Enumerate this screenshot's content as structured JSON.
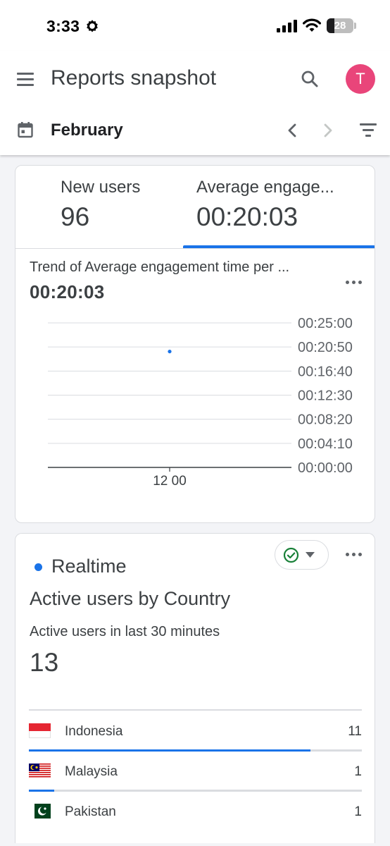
{
  "status_bar": {
    "time": "3:33",
    "battery_level": "28"
  },
  "header": {
    "title": "Reports snapshot",
    "avatar_initial": "T",
    "date_range": "February"
  },
  "metric_tabs": [
    {
      "label": "New users",
      "value": "96"
    },
    {
      "label": "Average engage...",
      "value": "00:20:03"
    }
  ],
  "selected_tab": 1,
  "trend_card": {
    "title": "Trend of Average engagement time per ...",
    "value": "00:20:03"
  },
  "chart_data": {
    "type": "scatter",
    "title": "Trend of Average engagement time per ...",
    "x_tick_labels": [
      "12 00"
    ],
    "y_tick_labels": [
      "00:25:00",
      "00:20:50",
      "00:16:40",
      "00:12:30",
      "00:08:20",
      "00:04:10",
      "00:00:00"
    ],
    "y_tick_seconds": [
      1500,
      1250,
      1000,
      750,
      500,
      250,
      0
    ],
    "ylim_seconds": [
      0,
      1500
    ],
    "x_categories": [
      "12 00"
    ],
    "series": [
      {
        "values_seconds": [
          1203
        ],
        "color": "#1a73e8"
      }
    ],
    "grid": true,
    "y_axis_side": "right"
  },
  "realtime_card": {
    "badge": "Realtime",
    "heading": "Active users by Country",
    "metric_label": "Active users in last 30 minutes",
    "metric_value": "13",
    "countries": [
      {
        "name": "Indonesia",
        "count": "11",
        "share": 0.846
      },
      {
        "name": "Malaysia",
        "count": "1",
        "share": 0.077
      },
      {
        "name": "Pakistan",
        "count": "1",
        "share": 0.077
      }
    ]
  },
  "colors": {
    "accent": "#1a73e8",
    "avatar": "#e9457a",
    "check": "#188038"
  },
  "icons": [
    "gear-icon",
    "signal-icon",
    "wifi-icon",
    "battery-icon",
    "menu-icon",
    "search-icon",
    "calendar-icon",
    "chevron-left-icon",
    "chevron-right-icon",
    "filter-icon",
    "more-icon",
    "check-circle-icon",
    "dropdown-icon"
  ]
}
